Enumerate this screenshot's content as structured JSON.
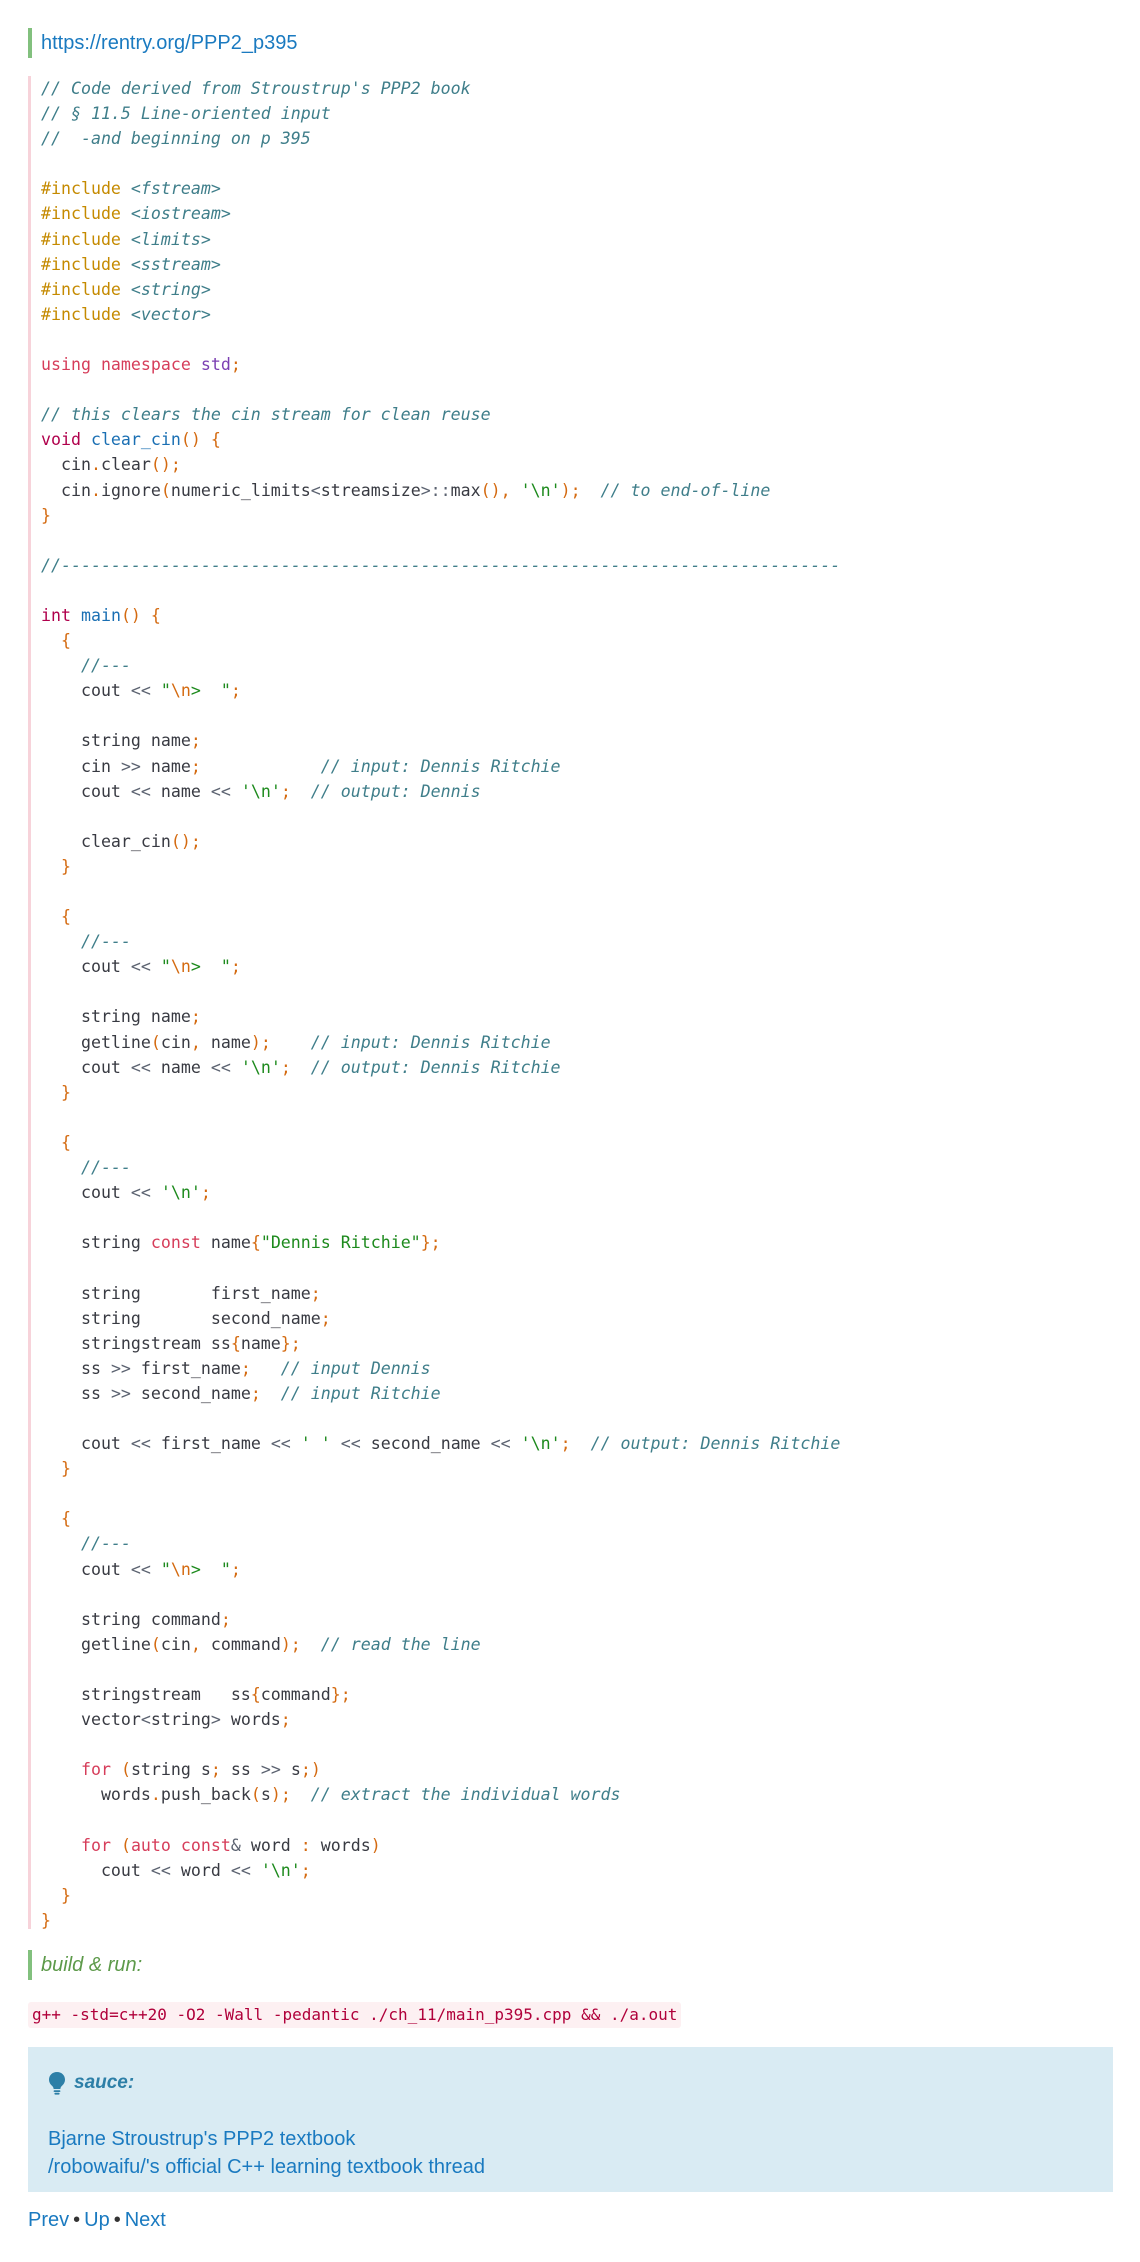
{
  "url_link": "https://rentry.org/PPP2_p395",
  "code_lines": [
    [
      [
        "// Code derived from Stroustrup's PPP2 book",
        "cmt"
      ]
    ],
    [
      [
        "// § 11.5 Line-oriented input",
        "cmt"
      ]
    ],
    [
      [
        "//  -and beginning on p 395",
        "cmt"
      ]
    ],
    [],
    [
      [
        "#include ",
        "pre"
      ],
      [
        "<fstream>",
        "inc"
      ]
    ],
    [
      [
        "#include ",
        "pre"
      ],
      [
        "<iostream>",
        "inc"
      ]
    ],
    [
      [
        "#include ",
        "pre"
      ],
      [
        "<limits>",
        "inc"
      ]
    ],
    [
      [
        "#include ",
        "pre"
      ],
      [
        "<sstream>",
        "inc"
      ]
    ],
    [
      [
        "#include ",
        "pre"
      ],
      [
        "<string>",
        "inc"
      ]
    ],
    [
      [
        "#include ",
        "pre"
      ],
      [
        "<vector>",
        "inc"
      ]
    ],
    [],
    [
      [
        "using namespace ",
        "kw"
      ],
      [
        "std",
        "ns"
      ],
      [
        ";",
        "pun"
      ]
    ],
    [],
    [
      [
        "// this clears the cin stream for clean reuse",
        "cmt"
      ]
    ],
    [
      [
        "void ",
        "typ"
      ],
      [
        "clear_cin",
        "fn"
      ],
      [
        "() {",
        "pun"
      ]
    ],
    [
      [
        "  cin",
        "plain"
      ],
      [
        ".",
        "pun"
      ],
      [
        "clear",
        "plain"
      ],
      [
        "();",
        "pun"
      ]
    ],
    [
      [
        "  cin",
        "plain"
      ],
      [
        ".",
        "pun"
      ],
      [
        "ignore",
        "plain"
      ],
      [
        "(",
        "pun"
      ],
      [
        "numeric_limits",
        "plain"
      ],
      [
        "<",
        "op"
      ],
      [
        "streamsize",
        "plain"
      ],
      [
        ">::",
        "op"
      ],
      [
        "max",
        "plain"
      ],
      [
        "(), ",
        "pun"
      ],
      [
        "'\\n'",
        "str"
      ],
      [
        ");",
        "pun"
      ],
      [
        "  // to end-of-line",
        "cmt"
      ]
    ],
    [
      [
        "}",
        "pun"
      ]
    ],
    [],
    [
      [
        "//------------------------------------------------------------------------------",
        "cmt"
      ]
    ],
    [],
    [
      [
        "int ",
        "typ"
      ],
      [
        "main",
        "fn"
      ],
      [
        "() {",
        "pun"
      ]
    ],
    [
      [
        "  {",
        "pun"
      ]
    ],
    [
      [
        "    //---",
        "cmt"
      ]
    ],
    [
      [
        "    cout ",
        "plain"
      ],
      [
        "<< ",
        "op"
      ],
      [
        "\"",
        "str"
      ],
      [
        "\\n",
        "pun"
      ],
      [
        ">  \"",
        "str"
      ],
      [
        ";",
        "pun"
      ]
    ],
    [],
    [
      [
        "    string name",
        "plain"
      ],
      [
        ";",
        "pun"
      ]
    ],
    [
      [
        "    cin ",
        "plain"
      ],
      [
        ">> ",
        "op"
      ],
      [
        "name",
        "plain"
      ],
      [
        ";",
        "pun"
      ],
      [
        "            // input: Dennis Ritchie",
        "cmt"
      ]
    ],
    [
      [
        "    cout ",
        "plain"
      ],
      [
        "<< ",
        "op"
      ],
      [
        "name ",
        "plain"
      ],
      [
        "<< ",
        "op"
      ],
      [
        "'\\n'",
        "str"
      ],
      [
        ";",
        "pun"
      ],
      [
        "  // output: Dennis",
        "cmt"
      ]
    ],
    [],
    [
      [
        "    clear_cin",
        "plain"
      ],
      [
        "();",
        "pun"
      ]
    ],
    [
      [
        "  }",
        "pun"
      ]
    ],
    [],
    [
      [
        "  {",
        "pun"
      ]
    ],
    [
      [
        "    //---",
        "cmt"
      ]
    ],
    [
      [
        "    cout ",
        "plain"
      ],
      [
        "<< ",
        "op"
      ],
      [
        "\"",
        "str"
      ],
      [
        "\\n",
        "pun"
      ],
      [
        ">  \"",
        "str"
      ],
      [
        ";",
        "pun"
      ]
    ],
    [],
    [
      [
        "    string name",
        "plain"
      ],
      [
        ";",
        "pun"
      ]
    ],
    [
      [
        "    getline",
        "plain"
      ],
      [
        "(",
        "pun"
      ],
      [
        "cin",
        "plain"
      ],
      [
        ", ",
        "pun"
      ],
      [
        "name",
        "plain"
      ],
      [
        ");",
        "pun"
      ],
      [
        "    // input: Dennis Ritchie",
        "cmt"
      ]
    ],
    [
      [
        "    cout ",
        "plain"
      ],
      [
        "<< ",
        "op"
      ],
      [
        "name ",
        "plain"
      ],
      [
        "<< ",
        "op"
      ],
      [
        "'\\n'",
        "str"
      ],
      [
        ";",
        "pun"
      ],
      [
        "  // output: Dennis Ritchie",
        "cmt"
      ]
    ],
    [
      [
        "  }",
        "pun"
      ]
    ],
    [],
    [
      [
        "  {",
        "pun"
      ]
    ],
    [
      [
        "    //---",
        "cmt"
      ]
    ],
    [
      [
        "    cout ",
        "plain"
      ],
      [
        "<< ",
        "op"
      ],
      [
        "'\\n'",
        "str"
      ],
      [
        ";",
        "pun"
      ]
    ],
    [],
    [
      [
        "    string ",
        "plain"
      ],
      [
        "const ",
        "kw"
      ],
      [
        "name",
        "plain"
      ],
      [
        "{",
        "pun"
      ],
      [
        "\"Dennis Ritchie\"",
        "str"
      ],
      [
        "};",
        "pun"
      ]
    ],
    [],
    [
      [
        "    string       first_name",
        "plain"
      ],
      [
        ";",
        "pun"
      ]
    ],
    [
      [
        "    string       second_name",
        "plain"
      ],
      [
        ";",
        "pun"
      ]
    ],
    [
      [
        "    stringstream ss",
        "plain"
      ],
      [
        "{",
        "pun"
      ],
      [
        "name",
        "plain"
      ],
      [
        "};",
        "pun"
      ]
    ],
    [
      [
        "    ss ",
        "plain"
      ],
      [
        ">> ",
        "op"
      ],
      [
        "first_name",
        "plain"
      ],
      [
        ";",
        "pun"
      ],
      [
        "   // input Dennis",
        "cmt"
      ]
    ],
    [
      [
        "    ss ",
        "plain"
      ],
      [
        ">> ",
        "op"
      ],
      [
        "second_name",
        "plain"
      ],
      [
        ";",
        "pun"
      ],
      [
        "  // input Ritchie",
        "cmt"
      ]
    ],
    [],
    [
      [
        "    cout ",
        "plain"
      ],
      [
        "<< ",
        "op"
      ],
      [
        "first_name ",
        "plain"
      ],
      [
        "<< ",
        "op"
      ],
      [
        "' '",
        "str"
      ],
      [
        " ",
        "plain"
      ],
      [
        "<< ",
        "op"
      ],
      [
        "second_name ",
        "plain"
      ],
      [
        "<< ",
        "op"
      ],
      [
        "'\\n'",
        "str"
      ],
      [
        ";",
        "pun"
      ],
      [
        "  // output: Dennis Ritchie",
        "cmt"
      ]
    ],
    [
      [
        "  }",
        "pun"
      ]
    ],
    [],
    [
      [
        "  {",
        "pun"
      ]
    ],
    [
      [
        "    //---",
        "cmt"
      ]
    ],
    [
      [
        "    cout ",
        "plain"
      ],
      [
        "<< ",
        "op"
      ],
      [
        "\"",
        "str"
      ],
      [
        "\\n",
        "pun"
      ],
      [
        ">  \"",
        "str"
      ],
      [
        ";",
        "pun"
      ]
    ],
    [],
    [
      [
        "    string command",
        "plain"
      ],
      [
        ";",
        "pun"
      ]
    ],
    [
      [
        "    getline",
        "plain"
      ],
      [
        "(",
        "pun"
      ],
      [
        "cin",
        "plain"
      ],
      [
        ", ",
        "pun"
      ],
      [
        "command",
        "plain"
      ],
      [
        ");",
        "pun"
      ],
      [
        "  // read the line",
        "cmt"
      ]
    ],
    [],
    [
      [
        "    stringstream   ss",
        "plain"
      ],
      [
        "{",
        "pun"
      ],
      [
        "command",
        "plain"
      ],
      [
        "};",
        "pun"
      ]
    ],
    [
      [
        "    vector",
        "plain"
      ],
      [
        "<",
        "op"
      ],
      [
        "string",
        "plain"
      ],
      [
        "> ",
        "op"
      ],
      [
        "words",
        "plain"
      ],
      [
        ";",
        "pun"
      ]
    ],
    [],
    [
      [
        "    for ",
        "kw"
      ],
      [
        "(",
        "pun"
      ],
      [
        "string s",
        "plain"
      ],
      [
        "; ",
        "pun"
      ],
      [
        "ss ",
        "plain"
      ],
      [
        ">> ",
        "op"
      ],
      [
        "s",
        "plain"
      ],
      [
        ";)",
        "pun"
      ]
    ],
    [
      [
        "      words",
        "plain"
      ],
      [
        ".",
        "pun"
      ],
      [
        "push_back",
        "plain"
      ],
      [
        "(",
        "pun"
      ],
      [
        "s",
        "plain"
      ],
      [
        ");",
        "pun"
      ],
      [
        "  // extract the individual words",
        "cmt"
      ]
    ],
    [],
    [
      [
        "    for ",
        "kw"
      ],
      [
        "(",
        "pun"
      ],
      [
        "auto const",
        "kw"
      ],
      [
        "& ",
        "op"
      ],
      [
        "word ",
        "plain"
      ],
      [
        ": ",
        "pun"
      ],
      [
        "words",
        "plain"
      ],
      [
        ")",
        "pun"
      ]
    ],
    [
      [
        "      cout ",
        "plain"
      ],
      [
        "<< ",
        "op"
      ],
      [
        "word ",
        "plain"
      ],
      [
        "<< ",
        "op"
      ],
      [
        "'\\n'",
        "str"
      ],
      [
        ";",
        "pun"
      ]
    ],
    [
      [
        "  }",
        "pun"
      ]
    ],
    [
      [
        "}",
        "pun"
      ]
    ]
  ],
  "build_label": "build & run:",
  "build_command": "g++ -std=c++20 -O2 -Wall -pedantic ./ch_11/main_p395.cpp && ./a.out",
  "sauce": {
    "icon": "lightbulb-icon",
    "title": "sauce:",
    "links": [
      "Bjarne Stroustrup's PPP2 textbook",
      "/robowaifu/'s official C++ learning textbook thread"
    ]
  },
  "nav": {
    "prev": "Prev",
    "up": "Up",
    "next": "Next",
    "separator": "•"
  },
  "colors": {
    "link": "#1a7ac0",
    "quote_bar": "#82c07e",
    "code_bar": "#f7d3da",
    "sauce_bg": "#d9ebf3",
    "cmd_text": "#b0003a"
  }
}
